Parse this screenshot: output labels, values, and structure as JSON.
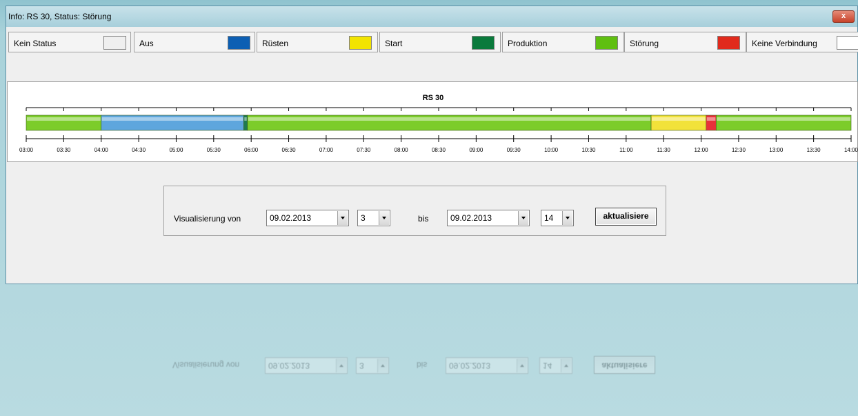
{
  "window": {
    "title": "Info: RS 30, Status: Störung",
    "close_label": "x"
  },
  "legend": [
    {
      "label": "Kein Status",
      "color": "#efefef"
    },
    {
      "label": "Aus",
      "color": "#0c5fb3"
    },
    {
      "label": "Rüsten",
      "color": "#f2e400"
    },
    {
      "label": "Start",
      "color": "#0a7a3c"
    },
    {
      "label": "Produktion",
      "color": "#5fbf10"
    },
    {
      "label": "Störung",
      "color": "#e02a1c"
    },
    {
      "label": "Keine Verbindung",
      "color": "#ffffff"
    }
  ],
  "chart_data": {
    "type": "timeline",
    "title": "RS 30",
    "tick_labels": [
      "03:00",
      "03:30",
      "04:00",
      "04:30",
      "05:00",
      "05:30",
      "06:00",
      "06:30",
      "07:00",
      "07:30",
      "08:00",
      "08:30",
      "09:00",
      "09:30",
      "10:00",
      "10:30",
      "11:00",
      "11:30",
      "12:00",
      "12:30",
      "13:00",
      "13:30",
      "14:00"
    ],
    "xlim": [
      "03:00",
      "14:00"
    ],
    "segments": [
      {
        "state": "Produktion",
        "start": "03:00",
        "end": "04:00",
        "color": "#7ccc2a"
      },
      {
        "state": "Aus",
        "start": "04:00",
        "end": "05:54",
        "color": "#5ea6dd"
      },
      {
        "state": "Start",
        "start": "05:54",
        "end": "05:57",
        "color": "#1f7a4e"
      },
      {
        "state": "Produktion",
        "start": "05:57",
        "end": "11:20",
        "color": "#7ccc2a"
      },
      {
        "state": "Rüsten",
        "start": "11:20",
        "end": "12:04",
        "color": "#f2e23a"
      },
      {
        "state": "Störung",
        "start": "12:04",
        "end": "12:12",
        "color": "#e8323a"
      },
      {
        "state": "Produktion",
        "start": "12:12",
        "end": "14:00",
        "color": "#7ccc2a"
      }
    ]
  },
  "controls": {
    "from_label": "Visualisierung von",
    "from_date": "09.02.2013",
    "from_hour": "3",
    "to_label": "bis",
    "to_date": "09.02.2013",
    "to_hour": "14",
    "refresh_label": "aktualisiere"
  }
}
